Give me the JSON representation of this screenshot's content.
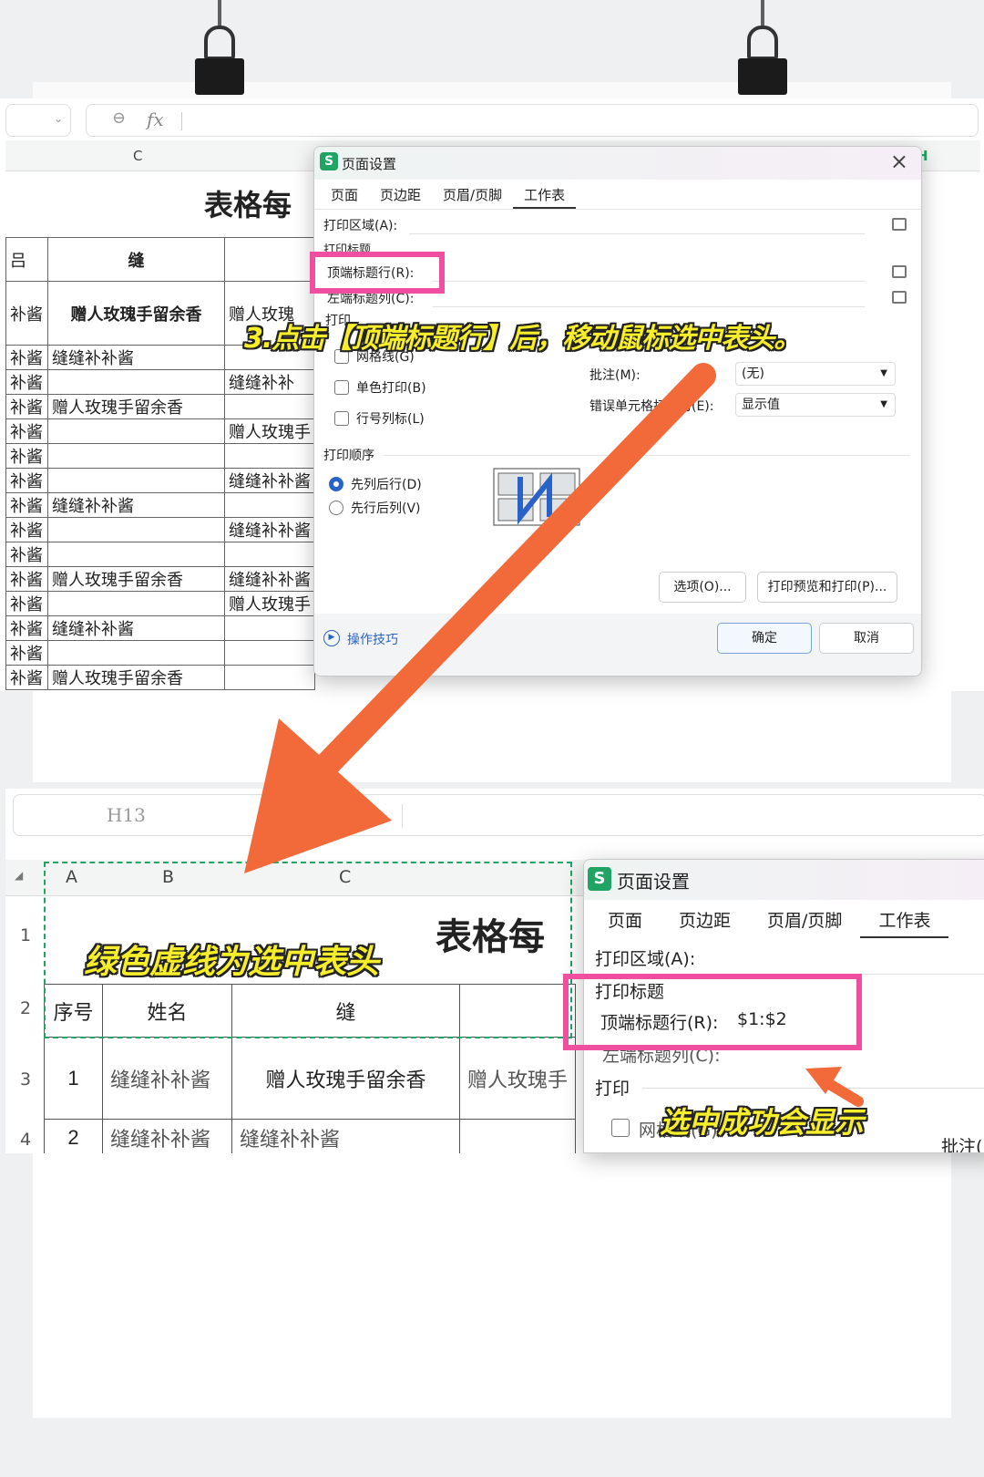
{
  "top": {
    "formula_icon": "fx",
    "col_c": "C",
    "col_h": "H",
    "sheet_title": "表格每",
    "header_col_b": "缝",
    "rows": [
      {
        "a": "补酱",
        "b": "赠人玫瑰手留余香",
        "c": "赠人玫瑰"
      },
      {
        "a": "补酱",
        "b": "缝缝补补酱",
        "c": ""
      },
      {
        "a": "补酱",
        "b": "",
        "c": "缝缝补补"
      },
      {
        "a": "补酱",
        "b": "赠人玫瑰手留余香",
        "c": ""
      },
      {
        "a": "补酱",
        "b": "",
        "c": "赠人玫瑰手"
      },
      {
        "a": "补酱",
        "b": "",
        "c": ""
      },
      {
        "a": "补酱",
        "b": "",
        "c": "缝缝补补酱"
      },
      {
        "a": "补酱",
        "b": "缝缝补补酱",
        "c": ""
      },
      {
        "a": "补酱",
        "b": "",
        "c": "缝缝补补酱"
      },
      {
        "a": "补酱",
        "b": "",
        "c": ""
      },
      {
        "a": "补酱",
        "b": "赠人玫瑰手留余香",
        "c": "缝缝补补酱"
      },
      {
        "a": "补酱",
        "b": "",
        "c": "赠人玫瑰手"
      },
      {
        "a": "补酱",
        "b": "缝缝补补酱",
        "c": ""
      },
      {
        "a": "补酱",
        "b": "",
        "c": ""
      },
      {
        "a": "补酱",
        "b": "赠人玫瑰手留余香",
        "c": ""
      }
    ]
  },
  "dialog1": {
    "logo": "S",
    "title": "页面设置",
    "close": "×",
    "tabs": [
      "页面",
      "页边距",
      "页眉/页脚",
      "工作表"
    ],
    "print_area_label": "打印区域(A):",
    "print_titles_label": "打印标题",
    "top_rows_label": "顶端标题行(R):",
    "left_cols_label": "左端标题列(C):",
    "print_label": "打印",
    "gridlines": "网格线(G)",
    "mono": "单色打印(B)",
    "rowcol": "行号列标(L)",
    "comments_label": "批注(M):",
    "comments_value": "(无)",
    "errors_label": "错误单元格打印为(E):",
    "errors_value": "显示值",
    "order_label": "打印顺序",
    "order_down": "先列后行(D)",
    "order_over": "先行后列(V)",
    "options_btn": "选项(O)...",
    "preview_btn": "打印预览和打印(P)...",
    "tips": "操作技巧",
    "ok": "确定",
    "cancel": "取消"
  },
  "caption1": "3.点击【顶端标题行】后，移动鼠标选中表头。",
  "bottom": {
    "name_box": "H13",
    "cols": [
      "A",
      "B",
      "C"
    ],
    "row_nums": [
      "1",
      "2",
      "3",
      "4"
    ],
    "title": "表格每",
    "headers": [
      "序号",
      "姓名",
      "缝"
    ],
    "row3": [
      "1",
      "缝缝补补酱",
      "赠人玫瑰手留余香",
      "赠人玫瑰手"
    ],
    "row4": [
      "2",
      "缝缝补补酱",
      "缝缝补补酱"
    ],
    "caption_green": "绿色虚线为选中表头",
    "caption_success": "选中成功会显示"
  },
  "dialog2": {
    "logo": "S",
    "title": "页面设置",
    "tabs": [
      "页面",
      "页边距",
      "页眉/页脚",
      "工作表"
    ],
    "print_area_label": "打印区域(A):",
    "print_titles_label": "打印标题",
    "top_rows_label": "顶端标题行(R):",
    "top_rows_value": "$1:$2",
    "left_cols_label": "左端标题列(C):",
    "print_label": "打印",
    "gridlines": "网格线(G)",
    "comments_label": "批注("
  },
  "colors": {
    "arrow": "#f26a3a",
    "highlight": "#ee4f9f",
    "caption": "#f6ee2a",
    "green": "#1fa463"
  }
}
